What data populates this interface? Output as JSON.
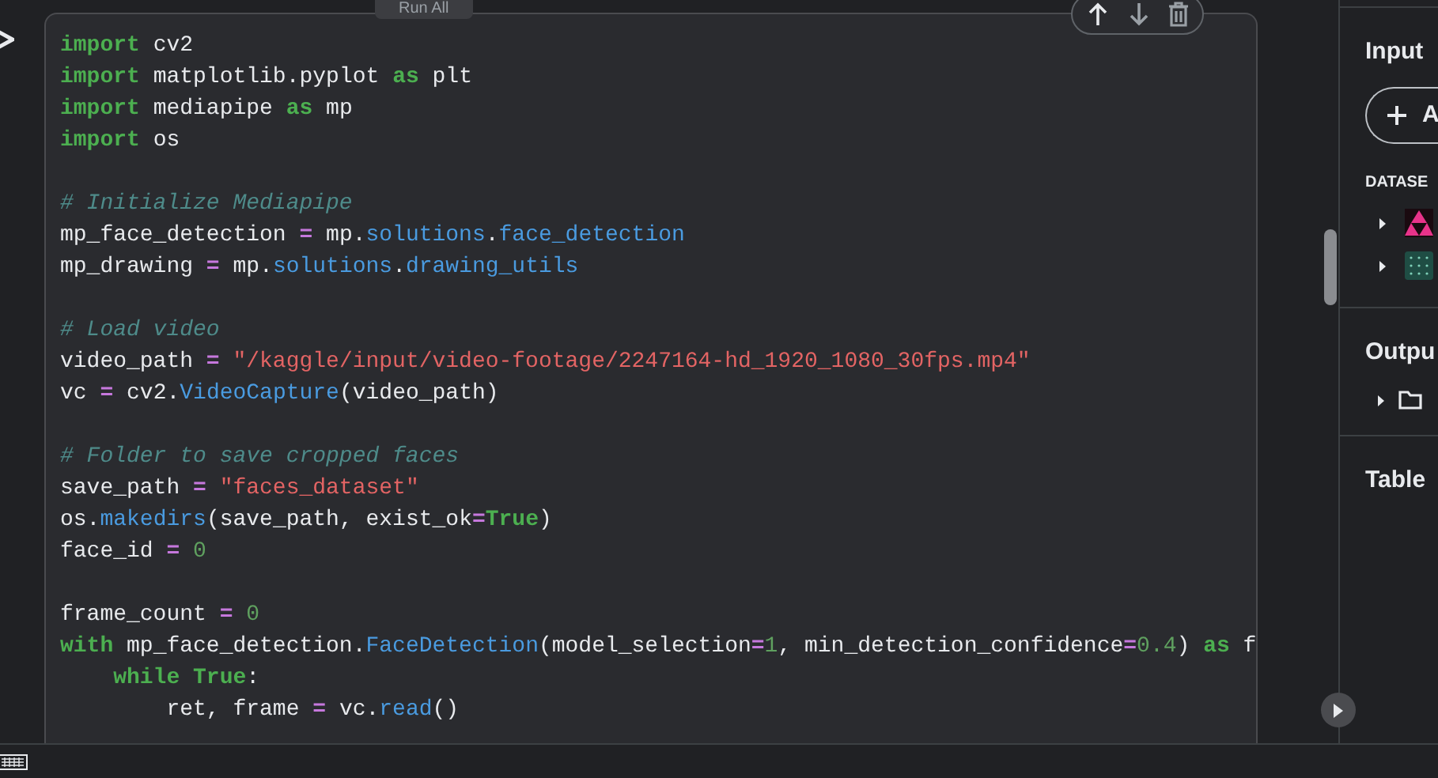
{
  "cell_toolbar": {
    "run_all": "Run All"
  },
  "code_lines": [
    {
      "kind": "code",
      "tokens": [
        {
          "kind": "keyword",
          "text": "import"
        },
        {
          "kind": "plain",
          "text": " cv2"
        }
      ]
    },
    {
      "kind": "code",
      "tokens": [
        {
          "kind": "keyword",
          "text": "import"
        },
        {
          "kind": "plain",
          "text": " matplotlib.pyplot "
        },
        {
          "kind": "keyword",
          "text": "as"
        },
        {
          "kind": "plain",
          "text": " plt"
        }
      ]
    },
    {
      "kind": "code",
      "tokens": [
        {
          "kind": "keyword",
          "text": "import"
        },
        {
          "kind": "plain",
          "text": " mediapipe "
        },
        {
          "kind": "keyword",
          "text": "as"
        },
        {
          "kind": "plain",
          "text": " mp"
        }
      ]
    },
    {
      "kind": "code",
      "tokens": [
        {
          "kind": "keyword",
          "text": "import"
        },
        {
          "kind": "plain",
          "text": " os"
        }
      ]
    },
    {
      "kind": "blank"
    },
    {
      "kind": "code",
      "tokens": [
        {
          "kind": "comment",
          "text": "# Initialize Mediapipe"
        }
      ]
    },
    {
      "kind": "code",
      "tokens": [
        {
          "kind": "plain",
          "text": "mp_face_detection "
        },
        {
          "kind": "operator",
          "text": "="
        },
        {
          "kind": "plain",
          "text": " mp."
        },
        {
          "kind": "function",
          "text": "solutions"
        },
        {
          "kind": "plain",
          "text": "."
        },
        {
          "kind": "function",
          "text": "face_detection"
        }
      ]
    },
    {
      "kind": "code",
      "tokens": [
        {
          "kind": "plain",
          "text": "mp_drawing "
        },
        {
          "kind": "operator",
          "text": "="
        },
        {
          "kind": "plain",
          "text": " mp."
        },
        {
          "kind": "function",
          "text": "solutions"
        },
        {
          "kind": "plain",
          "text": "."
        },
        {
          "kind": "function",
          "text": "drawing_utils"
        }
      ]
    },
    {
      "kind": "blank"
    },
    {
      "kind": "code",
      "tokens": [
        {
          "kind": "comment",
          "text": "# Load video"
        }
      ]
    },
    {
      "kind": "code",
      "tokens": [
        {
          "kind": "plain",
          "text": "video_path "
        },
        {
          "kind": "operator",
          "text": "="
        },
        {
          "kind": "string",
          "text": " \"/kaggle/input/video-footage/2247164-hd_1920_1080_30fps.mp4\""
        }
      ]
    },
    {
      "kind": "code",
      "tokens": [
        {
          "kind": "plain",
          "text": "vc "
        },
        {
          "kind": "operator",
          "text": "="
        },
        {
          "kind": "plain",
          "text": " cv2."
        },
        {
          "kind": "function",
          "text": "VideoCapture"
        },
        {
          "kind": "plain",
          "text": "(video_path)"
        }
      ]
    },
    {
      "kind": "blank"
    },
    {
      "kind": "code",
      "tokens": [
        {
          "kind": "comment",
          "text": "# Folder to save cropped faces"
        }
      ]
    },
    {
      "kind": "code",
      "tokens": [
        {
          "kind": "plain",
          "text": "save_path "
        },
        {
          "kind": "operator",
          "text": "="
        },
        {
          "kind": "string",
          "text": " \"faces_dataset\""
        }
      ]
    },
    {
      "kind": "code",
      "tokens": [
        {
          "kind": "plain",
          "text": "os."
        },
        {
          "kind": "function",
          "text": "makedirs"
        },
        {
          "kind": "plain",
          "text": "(save_path, exist_ok"
        },
        {
          "kind": "operator",
          "text": "="
        },
        {
          "kind": "keyword",
          "text": "True"
        },
        {
          "kind": "plain",
          "text": ")"
        }
      ]
    },
    {
      "kind": "code",
      "tokens": [
        {
          "kind": "plain",
          "text": "face_id "
        },
        {
          "kind": "operator",
          "text": "="
        },
        {
          "kind": "number",
          "text": " 0"
        }
      ]
    },
    {
      "kind": "blank"
    },
    {
      "kind": "code",
      "tokens": [
        {
          "kind": "plain",
          "text": "frame_count "
        },
        {
          "kind": "operator",
          "text": "="
        },
        {
          "kind": "number",
          "text": " 0"
        }
      ]
    },
    {
      "kind": "code",
      "tokens": [
        {
          "kind": "keyword",
          "text": "with"
        },
        {
          "kind": "plain",
          "text": " mp_face_detection."
        },
        {
          "kind": "function",
          "text": "FaceDetection"
        },
        {
          "kind": "plain",
          "text": "(model_selection"
        },
        {
          "kind": "operator",
          "text": "="
        },
        {
          "kind": "number",
          "text": "1"
        },
        {
          "kind": "plain",
          "text": ", min_detection_confidence"
        },
        {
          "kind": "operator",
          "text": "="
        },
        {
          "kind": "number",
          "text": "0.4"
        },
        {
          "kind": "plain",
          "text": ") "
        },
        {
          "kind": "keyword",
          "text": "as"
        },
        {
          "kind": "plain",
          "text": " f"
        }
      ]
    },
    {
      "kind": "code",
      "tokens": [
        {
          "kind": "keyword",
          "text": "    while"
        },
        {
          "kind": "keyword",
          "text": " True"
        },
        {
          "kind": "plain",
          "text": ":"
        }
      ]
    },
    {
      "kind": "code",
      "tokens": [
        {
          "kind": "plain",
          "text": "        ret, frame "
        },
        {
          "kind": "operator",
          "text": "="
        },
        {
          "kind": "plain",
          "text": " vc."
        },
        {
          "kind": "function",
          "text": "read"
        },
        {
          "kind": "plain",
          "text": "()"
        }
      ]
    }
  ],
  "side_panel": {
    "input_title": "Input",
    "add_button": "A",
    "datasets_label": "DATASE",
    "dataset_items": [
      {
        "kind": "triangles"
      },
      {
        "kind": "dots"
      }
    ],
    "output_title": "Outpu",
    "table_title": "Table"
  }
}
